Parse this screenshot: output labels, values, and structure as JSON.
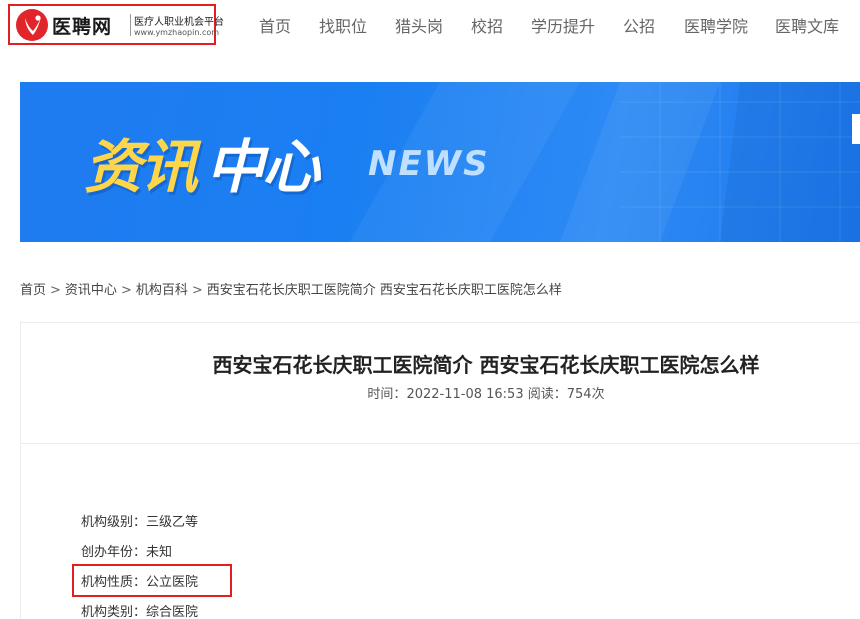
{
  "logo": {
    "name": "医聘网",
    "tagline": "医疗人职业机会平台",
    "url": "www.ymzhaopin.com",
    "accent": "#e0262a"
  },
  "nav": {
    "items": [
      {
        "label": "首页"
      },
      {
        "label": "找职位"
      },
      {
        "label": "猎头岗"
      },
      {
        "label": "校招"
      },
      {
        "label": "学历提升"
      },
      {
        "label": "公招"
      },
      {
        "label": "医聘学院"
      },
      {
        "label": "医聘文库"
      }
    ]
  },
  "banner": {
    "title_part1": "资讯",
    "title_part2": "中心",
    "subtitle": "NEWS",
    "bg_color": "#1f7bf0"
  },
  "breadcrumb": {
    "items": [
      "首页",
      "资讯中心",
      "机构百科",
      "西安宝石花长庆职工医院简介 西安宝石花长庆职工医院怎么样"
    ],
    "separator": ">"
  },
  "article": {
    "title": "西安宝石花长庆职工医院简介 西安宝石花长庆职工医院怎么样",
    "meta_time_label": "时间：",
    "meta_time": "2022-11-08 16:53",
    "meta_read_label": "阅读：",
    "meta_read": "754次",
    "info": [
      {
        "label": "机构级别：",
        "value": "三级乙等"
      },
      {
        "label": "创办年份：",
        "value": "未知"
      },
      {
        "label": "机构性质：",
        "value": "公立医院"
      },
      {
        "label": "机构类别：",
        "value": "综合医院"
      }
    ]
  }
}
